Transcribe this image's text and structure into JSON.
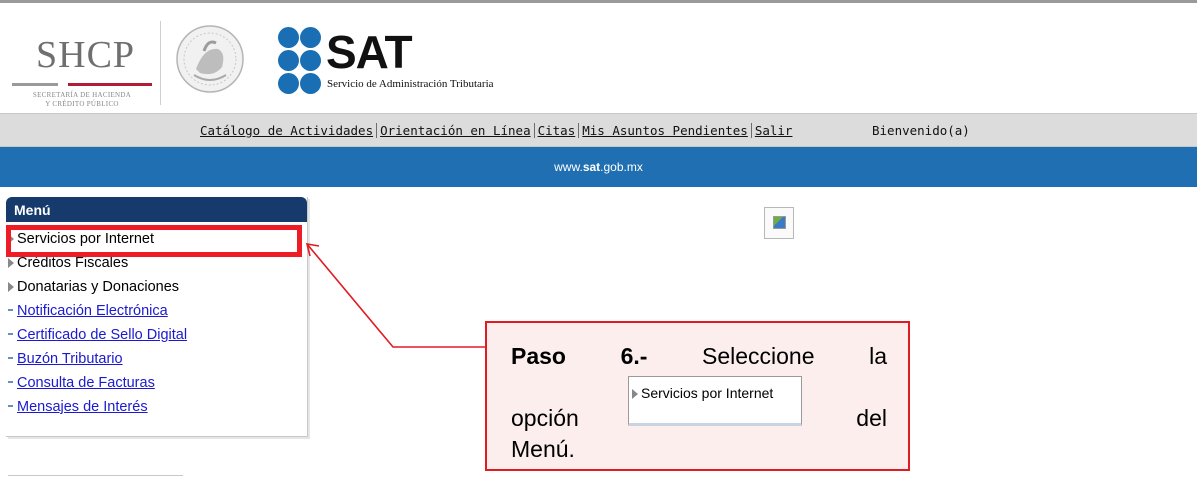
{
  "header": {
    "shcp_title": "SHCP",
    "shcp_subtitle_line1": "SECRETARÍA DE HACIENDA",
    "shcp_subtitle_line2": "Y CRÉDITO PÚBLICO",
    "sat_title": "SAT",
    "sat_subtitle": "Servicio de Administración Tributaria"
  },
  "nav": {
    "links": [
      "Catálogo de Actividades",
      "Orientación en Línea",
      "Citas",
      "Mis Asuntos Pendientes",
      "Salir"
    ],
    "welcome": "Bienvenido(a)"
  },
  "bluebar": {
    "url_prefix": "www.",
    "url_bold": "sat",
    "url_suffix": ".gob.mx"
  },
  "menu": {
    "title": "Menú",
    "items": [
      {
        "label": "Servicios por Internet",
        "type": "expandable"
      },
      {
        "label": "Créditos Fiscales",
        "type": "expandable"
      },
      {
        "label": "Donatarias y Donaciones",
        "type": "expandable"
      },
      {
        "label": "Notificación Electrónica",
        "type": "link"
      },
      {
        "label": "Certificado de Sello Digital",
        "type": "link"
      },
      {
        "label": "Buzón Tributario",
        "type": "link"
      },
      {
        "label": "Consulta de Facturas",
        "type": "link"
      },
      {
        "label": "Mensajes de Interés",
        "type": "link"
      }
    ]
  },
  "callout": {
    "paso": "Paso",
    "step": "6.-",
    "word_seleccione": "Seleccione",
    "word_la": "la",
    "word_opcion": "opción",
    "word_del": "del",
    "word_menu": "Menú.",
    "inline_item": "Servicios por Internet"
  },
  "colors": {
    "bluebar": "#1f6fb2",
    "menu_header": "#163a6b",
    "highlight": "#ee1c24",
    "callout_bg": "#fbeeed"
  }
}
